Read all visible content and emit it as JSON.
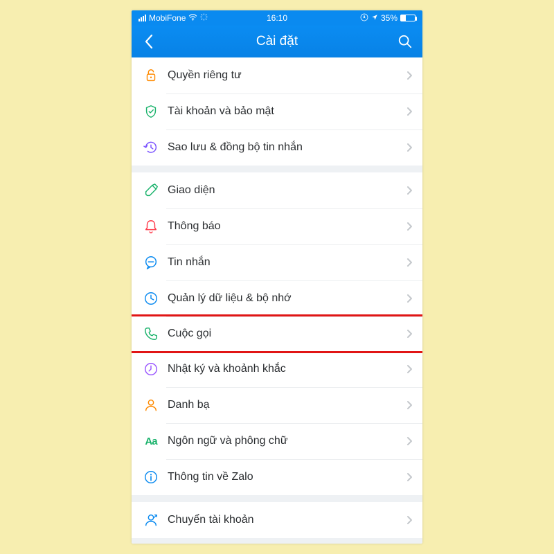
{
  "statusbar": {
    "carrier": "MobiFone",
    "time": "16:10",
    "battery_pct": "35%"
  },
  "navbar": {
    "title": "Cài đặt"
  },
  "groups": [
    {
      "items": [
        {
          "id": "privacy",
          "icon": "lock",
          "color": "#ff8a00",
          "label": "Quyền riêng tư"
        },
        {
          "id": "account",
          "icon": "shield",
          "color": "#19b26b",
          "label": "Tài khoản và bảo mật"
        },
        {
          "id": "backup",
          "icon": "history",
          "color": "#7a52ff",
          "label": "Sao lưu & đồng bộ tin nhắn"
        }
      ]
    },
    {
      "items": [
        {
          "id": "theme",
          "icon": "brush",
          "color": "#19b26b",
          "label": "Giao diện"
        },
        {
          "id": "notif",
          "icon": "bell",
          "color": "#ff3b4b",
          "label": "Thông báo"
        },
        {
          "id": "message",
          "icon": "chat",
          "color": "#0a8af0",
          "label": "Tin nhắn"
        },
        {
          "id": "storage",
          "icon": "clock",
          "color": "#0a8af0",
          "label": "Quản lý dữ liệu & bộ nhớ"
        },
        {
          "id": "call",
          "icon": "phone",
          "color": "#19b26b",
          "label": "Cuộc gọi",
          "highlight": true
        },
        {
          "id": "diary",
          "icon": "time",
          "color": "#9a56ff",
          "label": "Nhật ký và khoảnh khắc"
        },
        {
          "id": "contacts",
          "icon": "person",
          "color": "#ff8a00",
          "label": "Danh bạ"
        },
        {
          "id": "lang",
          "icon": "Aa",
          "color": "#19b26b",
          "label": "Ngôn ngữ và phông chữ"
        },
        {
          "id": "about",
          "icon": "info",
          "color": "#0a8af0",
          "label": "Thông tin về Zalo"
        }
      ]
    },
    {
      "items": [
        {
          "id": "switch",
          "icon": "switch",
          "color": "#0a8af0",
          "label": "Chuyển tài khoản"
        }
      ]
    }
  ]
}
